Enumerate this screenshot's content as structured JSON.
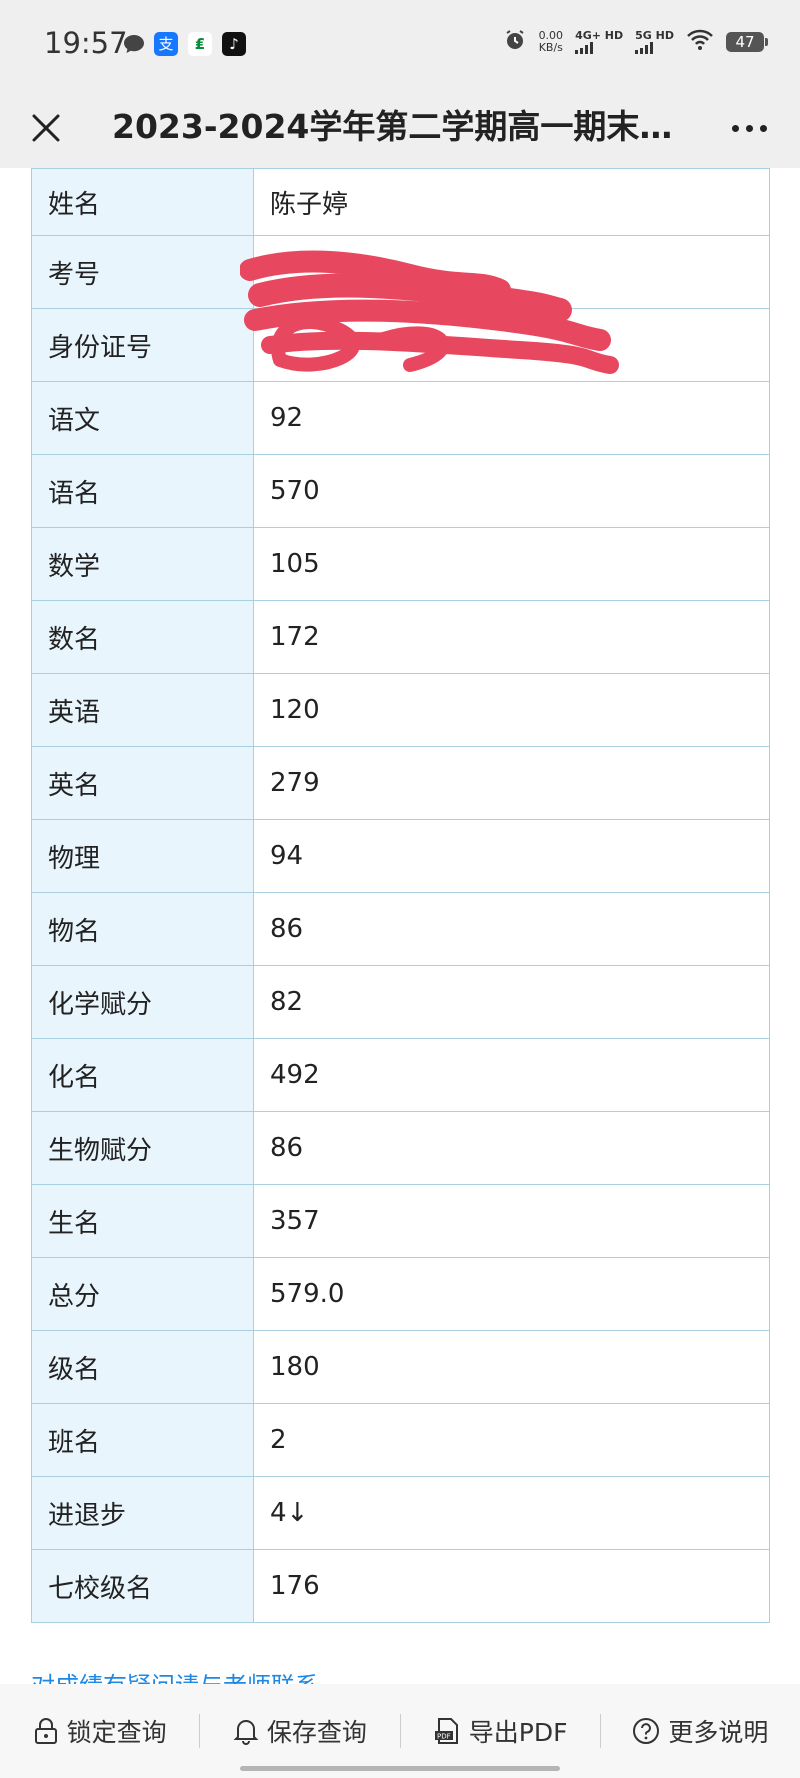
{
  "status_bar": {
    "time": "19:57",
    "speed_value": "0.00",
    "speed_unit": "KB/s",
    "net1": "4G+ HD",
    "net2": "5G HD",
    "battery": "47",
    "app_icons": [
      "message-icon",
      "alipay-icon",
      "green-app-icon",
      "tiktok-icon"
    ]
  },
  "header": {
    "title": "2023-2024学年第二学期高一期末…"
  },
  "table": {
    "rows": [
      {
        "label": "姓名",
        "value": "陈子婷"
      },
      {
        "label": "考号",
        "value": ""
      },
      {
        "label": "身份证号",
        "value": ""
      },
      {
        "label": "语文",
        "value": "92"
      },
      {
        "label": "语名",
        "value": "570"
      },
      {
        "label": "数学",
        "value": "105"
      },
      {
        "label": "数名",
        "value": "172"
      },
      {
        "label": "英语",
        "value": "120"
      },
      {
        "label": "英名",
        "value": "279"
      },
      {
        "label": "物理",
        "value": "94"
      },
      {
        "label": "物名",
        "value": "86"
      },
      {
        "label": "化学赋分",
        "value": "82"
      },
      {
        "label": "化名",
        "value": "492"
      },
      {
        "label": "生物赋分",
        "value": "86"
      },
      {
        "label": "生名",
        "value": "357"
      },
      {
        "label": "总分",
        "value": "579.0"
      },
      {
        "label": "级名",
        "value": "180"
      },
      {
        "label": "班名",
        "value": "2"
      },
      {
        "label": "进退步",
        "value": "4↓"
      },
      {
        "label": "七校级名",
        "value": "176"
      }
    ]
  },
  "partial_text": "对成绩有疑问请与老师联系",
  "toolbar": {
    "lock_label": "锁定查询",
    "save_label": "保存查询",
    "export_label": "导出PDF",
    "help_label": "更多说明"
  },
  "colors": {
    "label_bg": "#e8f5fd",
    "border": "#a9cfe0",
    "scribble": "#e8485f",
    "link": "#1e88e5"
  }
}
